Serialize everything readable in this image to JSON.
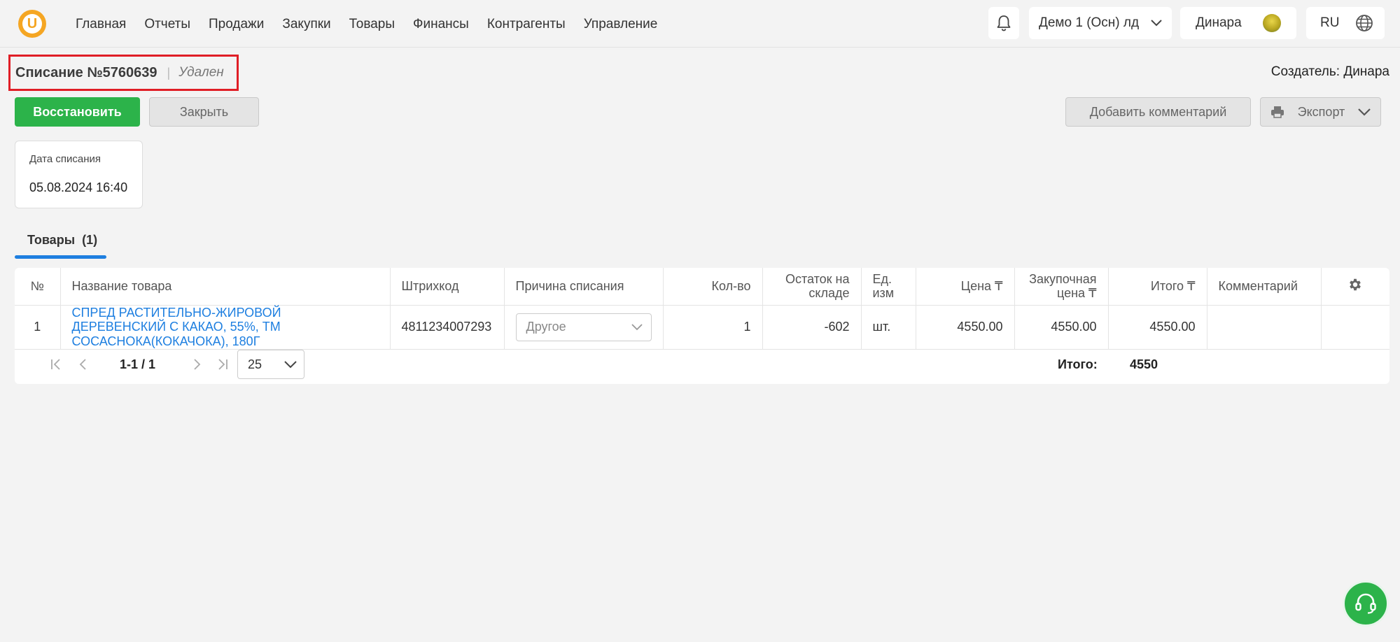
{
  "nav": {
    "items": [
      "Главная",
      "Отчеты",
      "Продажи",
      "Закупки",
      "Товары",
      "Финансы",
      "Контрагенты",
      "Управление"
    ],
    "org_selector": "Демо 1 (Осн) лд",
    "user_name": "Динара",
    "language": "RU"
  },
  "document": {
    "title": "Списание №5760639",
    "status": "Удален",
    "creator": "Создатель: Динара"
  },
  "actions": {
    "restore": "Восстановить",
    "close": "Закрыть",
    "add_comment": "Добавить комментарий",
    "export": "Экспорт"
  },
  "date_card": {
    "label": "Дата списания",
    "value": "05.08.2024 16:40"
  },
  "tabs": {
    "goods": "Товары",
    "goods_count": "(1)"
  },
  "table": {
    "headers": {
      "num": "№",
      "name": "Название товара",
      "barcode": "Штрихкод",
      "reason": "Причина списания",
      "qty": "Кол-во",
      "stock": "Остаток на складе",
      "unit": "Ед. изм",
      "price": "Цена ₸",
      "purchase_price": "Закупочная цена ₸",
      "total": "Итого ₸",
      "comment": "Комментарий"
    },
    "rows": [
      {
        "num": "1",
        "name": "СПРЕД РАСТИТЕЛЬНО-ЖИРОВОЙ ДЕРЕВЕНСКИЙ С КАКАО, 55%, ТМ СОСАСНОКА(КОКАЧОКА), 180Г",
        "barcode": "4811234007293",
        "reason": "Другое",
        "qty": "1",
        "stock": "-602",
        "unit": "шт.",
        "price": "4550.00",
        "purchase_price": "4550.00",
        "total": "4550.00",
        "comment": ""
      }
    ]
  },
  "pagination": {
    "range": "1-1 / 1",
    "page_size": "25"
  },
  "summary": {
    "label": "Итого:",
    "value": "4550"
  },
  "colors": {
    "accent_green": "#2cb34a",
    "link_blue": "#1e7fe0",
    "highlight_red": "#e01e26",
    "logo_orange": "#f5a623"
  }
}
